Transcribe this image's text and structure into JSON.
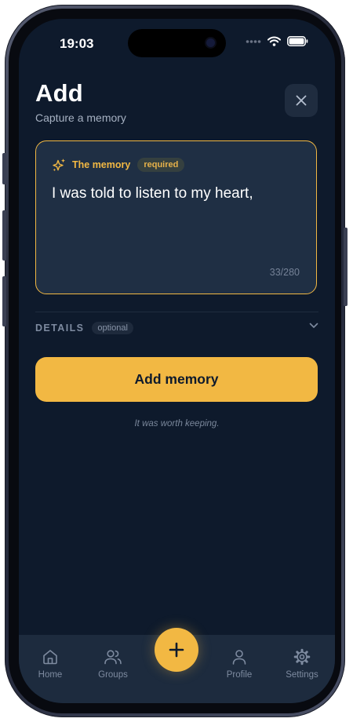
{
  "status_bar": {
    "time": "19:03"
  },
  "header": {
    "title": "Add",
    "subtitle": "Capture a memory"
  },
  "icons": {
    "close": "close-icon",
    "sparkle": "sparkles-icon",
    "chevron": "chevron-down-icon",
    "plus": "plus-icon"
  },
  "memory": {
    "label": "The memory",
    "badge": "required",
    "value": "I was told to listen to my heart,",
    "char_count": "33/280"
  },
  "details": {
    "label": "DETAILS",
    "badge": "optional"
  },
  "actions": {
    "add_label": "Add memory",
    "footer_note": "It was worth keeping."
  },
  "tabs": [
    {
      "label": "Home",
      "icon": "home-icon"
    },
    {
      "label": "Groups",
      "icon": "users-icon"
    },
    {
      "label": "Profile",
      "icon": "user-icon"
    },
    {
      "label": "Settings",
      "icon": "gear-icon"
    }
  ],
  "colors": {
    "background": "#0e1a2c",
    "accent": "#f2b843",
    "card": "#1f2f44",
    "tab_bar": "#1d2b3e",
    "muted_text": "#7e8ba0"
  }
}
